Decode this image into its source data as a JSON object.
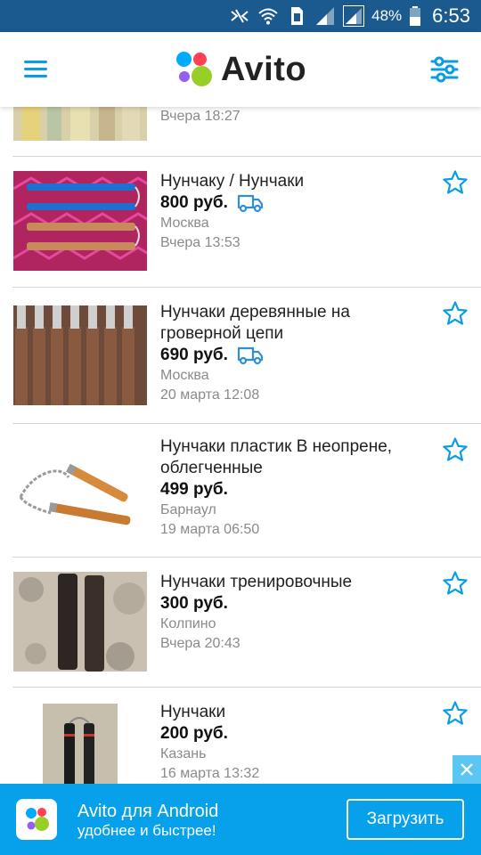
{
  "status_bar": {
    "battery": "48%",
    "time": "6:53",
    "icons": [
      "nfc-icon",
      "wifi-icon",
      "sim-icon",
      "signal-icon",
      "signal-icon",
      "battery-icon"
    ]
  },
  "app_bar": {
    "logo_text": "Avito",
    "menu_icon": "hamburger-icon",
    "filter_icon": "sliders-icon"
  },
  "listings": [
    {
      "title": "",
      "price": "",
      "city": "",
      "date": "Вчера 18:27",
      "delivery": false,
      "thumb": "partial-image"
    },
    {
      "title": "Нунчаку / Нунчаки",
      "price": "800 руб.",
      "city": "Москва",
      "date": "Вчера 13:53",
      "delivery": true,
      "thumb": "nunchaku-blue-wood-on-pink-rug"
    },
    {
      "title": "Нунчаки деревянные на гроверной цепи",
      "price": "690 руб.",
      "city": "Москва",
      "date": "20 марта 12:08",
      "delivery": true,
      "thumb": "wooden-nunchaku-rows"
    },
    {
      "title": "Нунчаки пластик В неопрене, облегченные",
      "price": "499 руб.",
      "city": "Барнаул",
      "date": "19 марта 06:50",
      "delivery": false,
      "thumb": "nunchaku-chain-white-bg"
    },
    {
      "title": "Нунчаки тренировочные",
      "price": "300 руб.",
      "city": "Колпино",
      "date": "Вчера 20:43",
      "delivery": false,
      "thumb": "dark-nunchaku-on-mat"
    },
    {
      "title": "Нунчаки",
      "price": "200 руб.",
      "city": "Казань",
      "date": "16 марта 13:32",
      "delivery": false,
      "thumb": "black-nunchaku-photo"
    }
  ],
  "banner": {
    "title": "Avito для Android",
    "subtitle": "удобнее и быстрее!",
    "button": "Загрузить"
  },
  "colors": {
    "status_bar": "#1b5a8e",
    "accent": "#0a9de6",
    "banner": "#06a1ea",
    "delivery": "#2f8fd6"
  }
}
